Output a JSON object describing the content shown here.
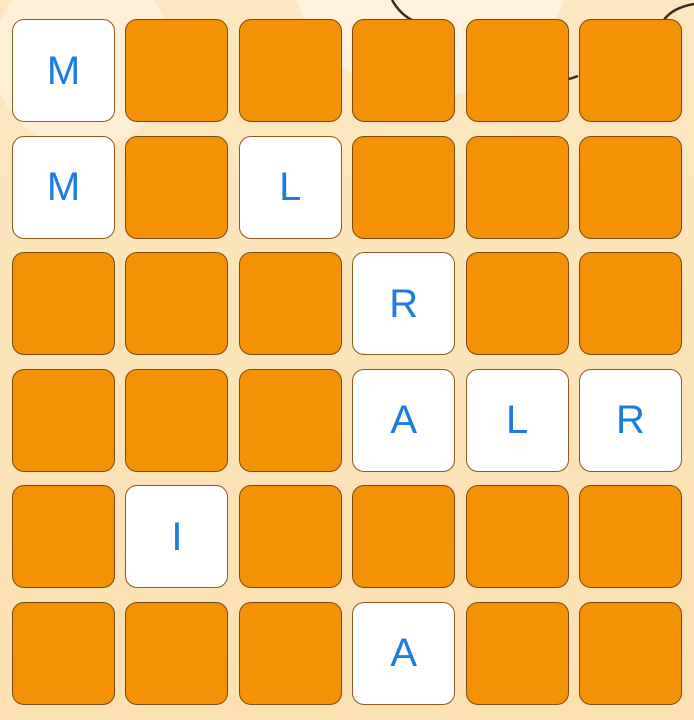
{
  "board": {
    "rows": 6,
    "cols": 6,
    "tiles": [
      [
        "M",
        "",
        "",
        "",
        "",
        ""
      ],
      [
        "M",
        "",
        "L",
        "",
        "",
        ""
      ],
      [
        "",
        "",
        "",
        "R",
        "",
        ""
      ],
      [
        "",
        "",
        "",
        "A",
        "L",
        "R"
      ],
      [
        "",
        "I",
        "",
        "",
        "",
        ""
      ],
      [
        "",
        "",
        "",
        "A",
        "",
        ""
      ]
    ]
  },
  "colors": {
    "hidden_tile": "#f59105",
    "revealed_tile": "#ffffff",
    "letter": "#1e7be0",
    "tile_border": "#7a4a12",
    "background": "#fce4b8"
  }
}
